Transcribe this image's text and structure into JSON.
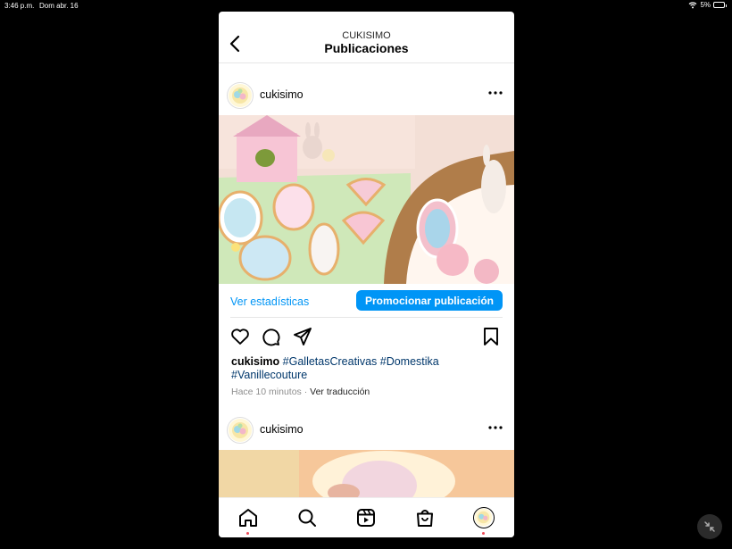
{
  "status_bar": {
    "time": "3:46 p.m.",
    "date": "Dom abr. 16",
    "battery": "5%"
  },
  "header": {
    "account": "CUKISIMO",
    "title": "Publicaciones"
  },
  "post": {
    "username": "cukisimo",
    "stats_link": "Ver estadísticas",
    "promote_label": "Promocionar publicación",
    "caption_user": "cukisimo",
    "caption_tags": "#GalletasCreativas #Domestika #Vanillecouture",
    "time_ago": "Hace 10 minutos",
    "translate_label": "Ver traducción"
  },
  "next_post": {
    "username": "cukisimo"
  },
  "icons": {
    "back": "chevron-left-icon",
    "more": "more-horizontal-icon",
    "like": "heart-icon",
    "comment": "comment-icon",
    "share": "send-icon",
    "save": "bookmark-icon",
    "home": "home-icon",
    "search": "search-icon",
    "reels": "reels-icon",
    "shop": "shop-icon",
    "profile": "avatar"
  },
  "colors": {
    "link_blue": "#0095f6",
    "hashtag_blue": "#00376b",
    "notification_dot": "#ed4956"
  }
}
